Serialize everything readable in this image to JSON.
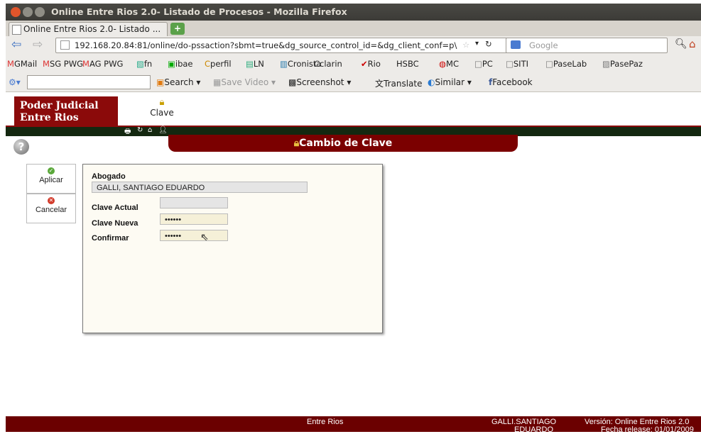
{
  "window": {
    "title": "Online Entre Rios 2.0- Listado de Procesos - Mozilla Firefox"
  },
  "tab": {
    "label": "Online Entre Rios 2.0- Listado ...",
    "new_tab": "+"
  },
  "nav": {
    "url": "192.168.20.84:81/online/do-pssaction?sbmt=true&dg_source_control_id=&dg_client_conf=p\\",
    "search_placeholder": "Google"
  },
  "bookmarks": [
    "GMail",
    "SG PWG",
    "AG PWG",
    "fn",
    "ibae",
    "perfil",
    "LN",
    "Cronista",
    "clarin",
    "Rio",
    "HSBC",
    "MC",
    "PC",
    "SITI",
    "PaseLab",
    "PasePaz"
  ],
  "toolbar": {
    "search": "Search",
    "save_video": "Save Video",
    "screenshot": "Screenshot",
    "translate": "Translate",
    "similar": "Similar",
    "facebook": "Facebook"
  },
  "app": {
    "logo_line1": "Poder Judicial",
    "logo_line2": "Entre Rios",
    "menu_clave": "Clave",
    "banner_title": "Cambio de Clave",
    "help_symbol": "?"
  },
  "actions": {
    "apply": "Aplicar",
    "cancel": "Cancelar"
  },
  "form": {
    "abogado_label": "Abogado",
    "abogado_value": "GALLI, SANTIAGO EDUARDO",
    "clave_actual_label": "Clave Actual",
    "clave_actual_value": "",
    "clave_nueva_label": "Clave Nueva",
    "clave_nueva_value": "••••••",
    "confirmar_label": "Confirmar",
    "confirmar_value": "••••••"
  },
  "footer": {
    "center": "Entre Rios",
    "user_line1": "GALLI.SANTIAGO",
    "user_line2": "EDUARDO",
    "version_line1": "Versión: Online Entre Rios 2.0",
    "version_line2": "Fecha release: 01/01/2009"
  },
  "colors": {
    "brand": "#8b0a0a",
    "banner": "#7b0000",
    "footer": "#6b0000"
  }
}
